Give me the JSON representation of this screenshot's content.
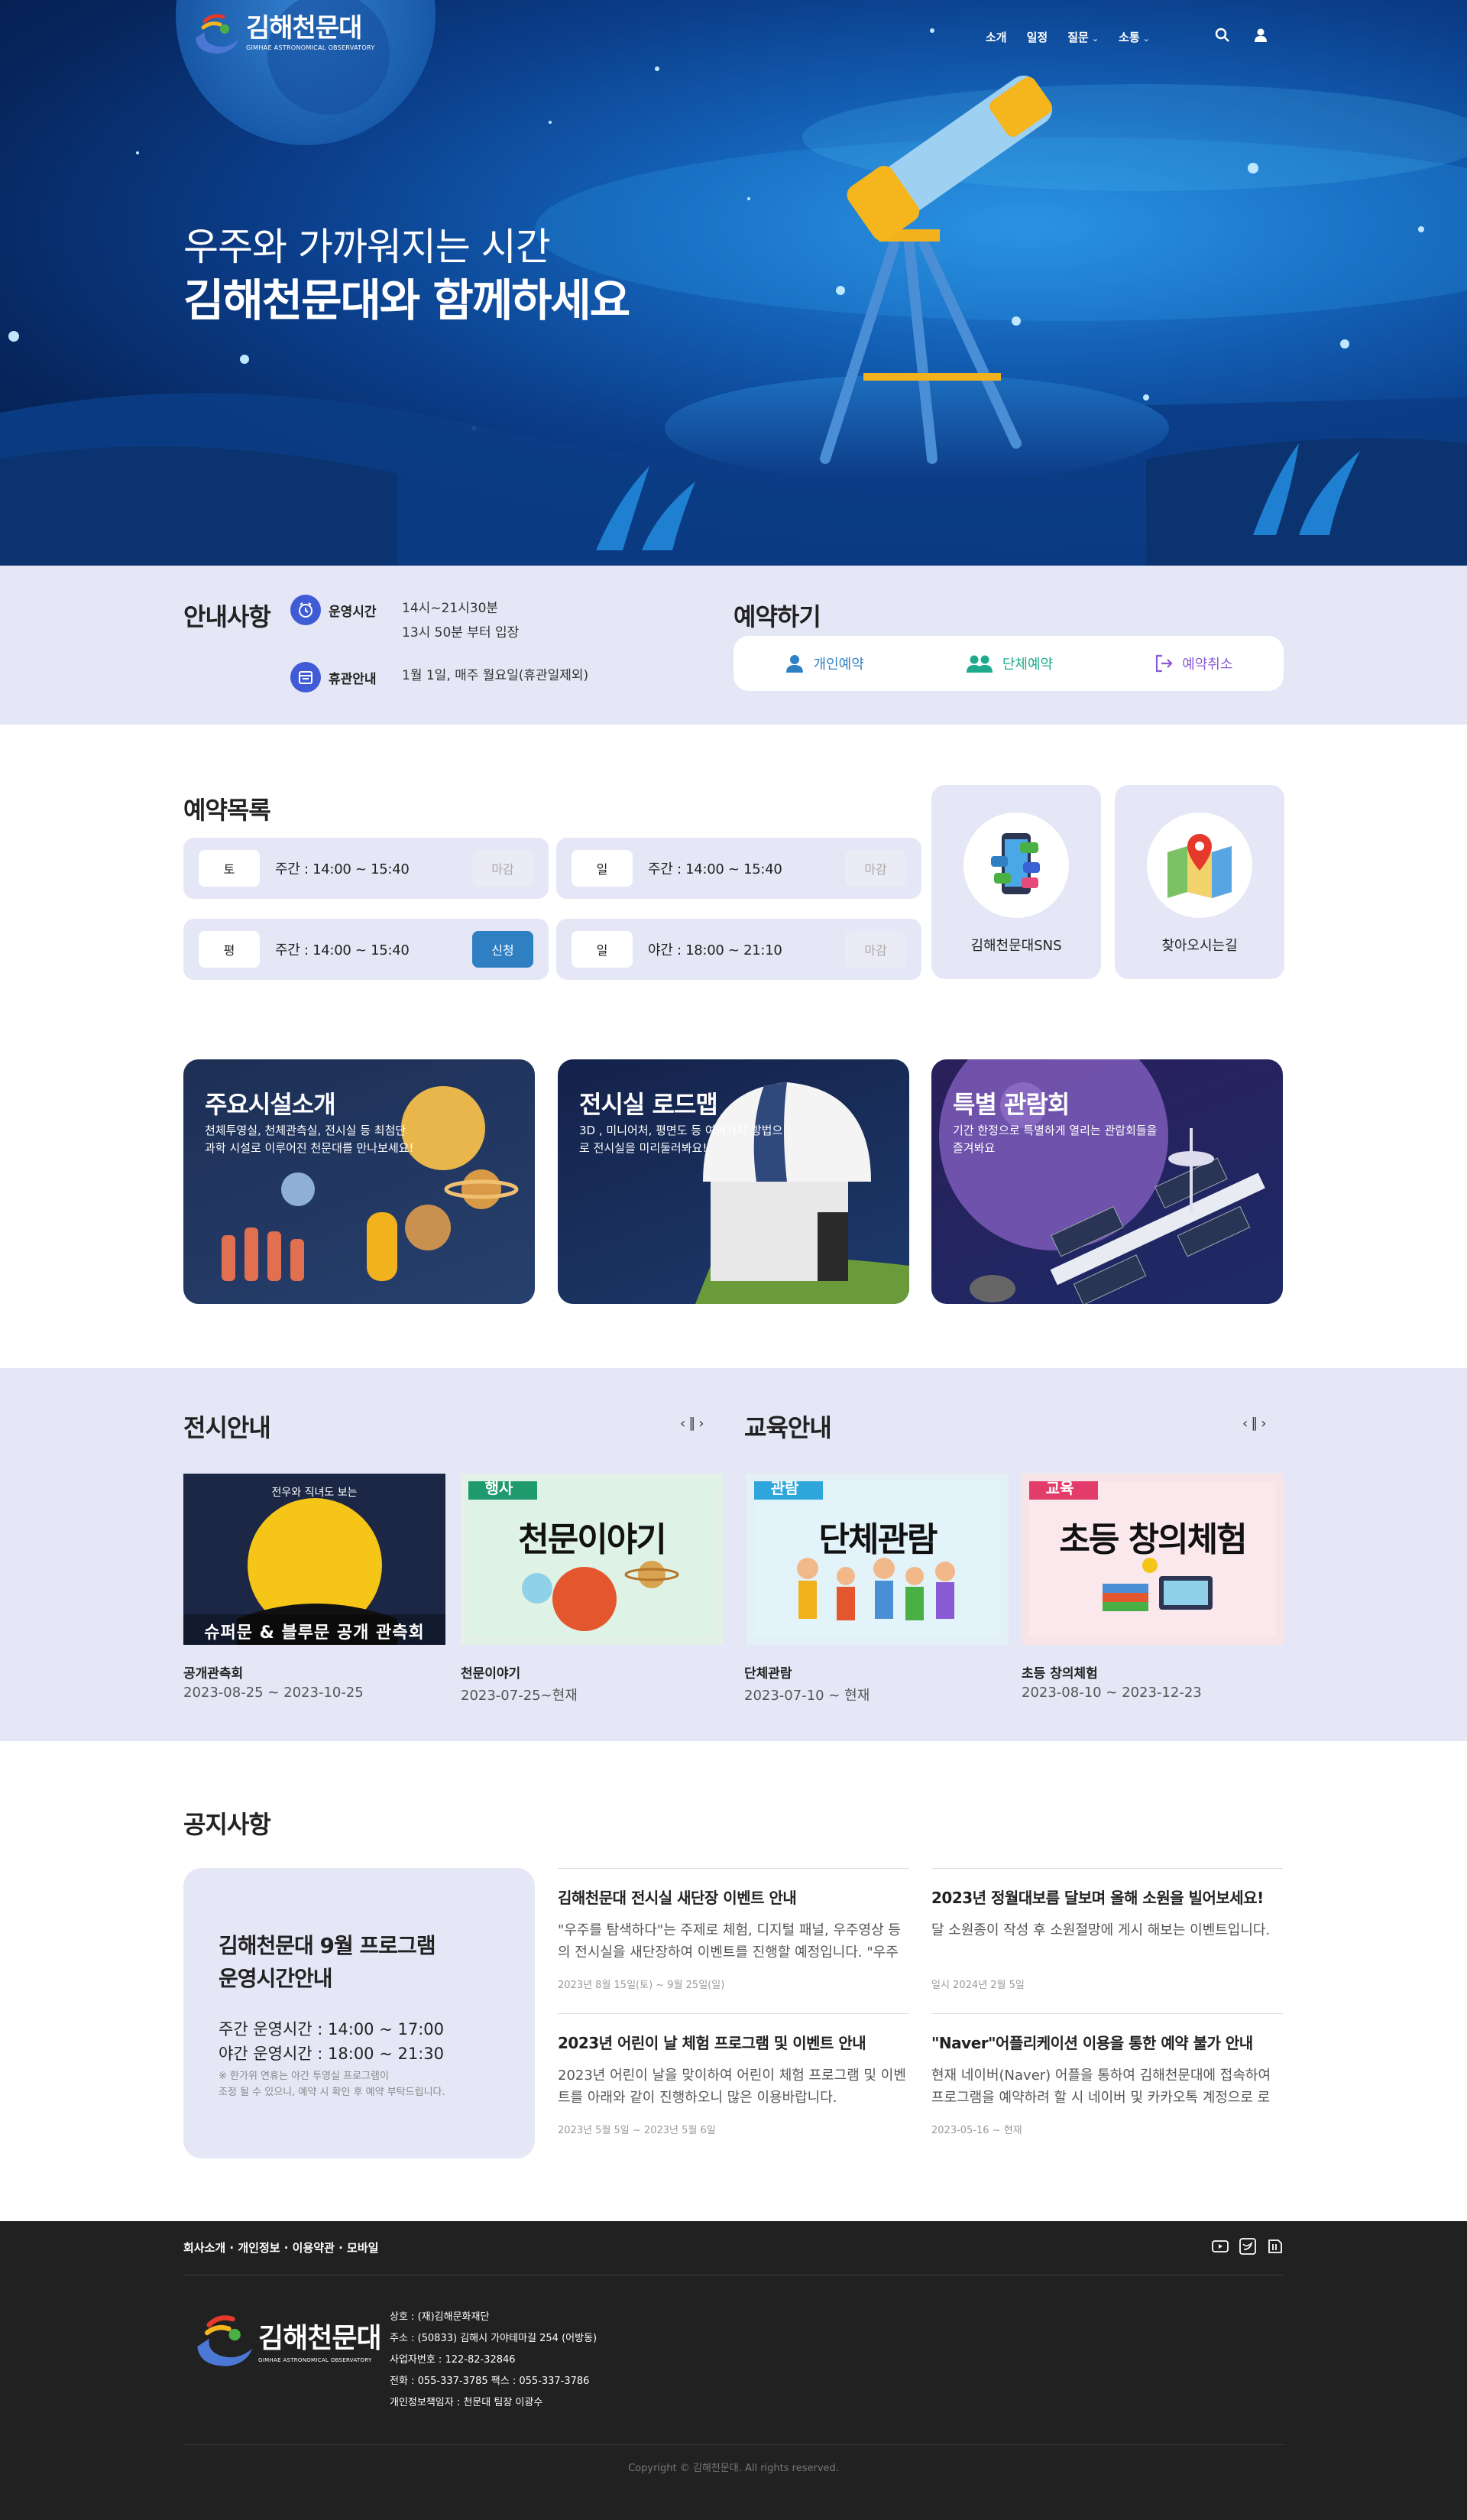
{
  "header": {
    "logo_ko": "김해천문대",
    "logo_en": "GIMHAE ASTRONOMICAL OBSERVATORY",
    "nav": [
      "소개",
      "일정",
      "질문",
      "소통"
    ],
    "hero_line1": "우주와 가까워지는 시간",
    "hero_line2": "김해천문대와 함께하세요"
  },
  "info": {
    "title": "안내사항",
    "hours_label": "운영시간",
    "hours_line1": "14시~21시30분",
    "hours_line2": "13시 50분 부터 입장",
    "closed_label": "휴관안내",
    "closed_value": "1월 1일, 매주 월요일(휴관일제외)"
  },
  "reserve": {
    "title": "예약하기",
    "personal": "개인예약",
    "group": "단체예약",
    "cancel": "예약취소"
  },
  "reservation_list": {
    "title": "예약목록",
    "slots": [
      {
        "day": "토",
        "time": "주간 : 14:00 ~ 15:40",
        "status": "마감"
      },
      {
        "day": "일",
        "time": "주간 : 14:00 ~ 15:40",
        "status": "마감"
      },
      {
        "day": "평",
        "time": "주간 : 14:00 ~ 15:40",
        "status": "신청"
      },
      {
        "day": "일",
        "time": "야간 : 18:00 ~ 21:10",
        "status": "마감"
      }
    ]
  },
  "quick": {
    "sns": "김해천문대SNS",
    "map": "찾아오시는길"
  },
  "banners": [
    {
      "title": "주요시설소개",
      "desc": "천체투영실, 천체관측실, 전시실 등 최첨단 과학 시설로 이루어진 천문대를 만나보세요!"
    },
    {
      "title": "전시실 로드맵",
      "desc": "3D , 미니어처, 평면도 등 여러가지 방법으로 전시실을 미리둘러봐요!"
    },
    {
      "title": "특별 관람회",
      "desc": "기간 한정으로 특별하게 열리는 관람회들을 즐겨봐요"
    }
  ],
  "exhibition": {
    "title": "전시안내",
    "items": [
      {
        "caption": "공개관측회",
        "date": "2023-08-25 ~ 2023-10-25",
        "img_top": "전우와 직녀도 보는",
        "img_bottom": "슈퍼문 & 블루문 공개 관측회"
      },
      {
        "caption": "천문이야기",
        "date": "2023-07-25~현재",
        "tag": "행사",
        "img_title": "천문이야기"
      }
    ]
  },
  "education": {
    "title": "교육안내",
    "items": [
      {
        "caption": "단체관람",
        "date": "2023-07-10 ~ 현재",
        "tag": "관람",
        "img_title": "단체관람"
      },
      {
        "caption": "초등 창의체험",
        "date": "2023-08-10 ~ 2023-12-23",
        "tag": "교육",
        "img_title": "초등 창의체험"
      }
    ]
  },
  "notice": {
    "title": "공지사항",
    "highlight": {
      "heading1": "김해천문대 9월 프로그램",
      "heading2": "운영시간안내",
      "line1": "주간 운영시간 : 14:00 ~ 17:00",
      "line2": "야간 운영시간 : 18:00 ~ 21:30",
      "small1": "※ 한가위 연휴는 야간 투영실 프로그램이",
      "small2": "조정 될 수 있으니, 예약 시 확인 후 예약 부탁드립니다."
    },
    "items": [
      {
        "title": "김해천문대 전시실 새단장 이벤트 안내",
        "desc": "\"우주를 탐색하다\"는 주제로 체험, 디지털 패널, 우주영상 등의 전시실을 새단장하여 이벤트를 진행할 예정입니다. \"우주를…",
        "meta": "2023년 8월 15일(토) ~ 9월 25일(일)"
      },
      {
        "title": "2023년 정월대보름 달보며 올해 소원을 빌어보세요!",
        "desc": "달 소원종이 작성 후 소원절망에 게시 해보는 이벤트입니다.",
        "meta": "일시 2024년 2월 5일"
      },
      {
        "title": "2023년 어린이 날 체험 프로그램 및 이벤트 안내",
        "desc": "2023년 어린이 날을 맞이하여 어린이 체험 프로그램 및 이벤트를 아래와 같이 진행하오니 많은 이용바랍니다.",
        "meta": "2023년 5월 5일 ~ 2023년 5월 6일"
      },
      {
        "title": "\"Naver\"어플리케이션 이용을 통한 예약 불가 안내",
        "desc": "현재 네이버(Naver) 어플을 통하여 김해천문대에 접속하여 프로그램을 예약하려 할 시 네이버 및 카카오톡 계정으로 로그…",
        "meta": "2023-05-16 ~ 현재"
      }
    ]
  },
  "footer": {
    "links": "회사소개 · 개인정보 · 이용약관 · 모바일",
    "logo_ko": "김해천문대",
    "logo_en": "GIMHAE ASTRONOMICAL OBSERVATORY",
    "info": [
      "상호 : (재)김해문화재단",
      "주소 : (50833) 김해시 가야테마길 254 (어방동)",
      "사업자번호 : 122-82-32846",
      "전화 : 055-337-3785 팩스 : 055-337-3786",
      "개인정보책임자 : 천문대 팀장 이광수"
    ],
    "copyright": "Copyright © 김해천문대. All rights reserved."
  },
  "colors": {
    "accent": "#2f7fc3",
    "panel": "#e6e7f6",
    "footer": "#212121"
  }
}
